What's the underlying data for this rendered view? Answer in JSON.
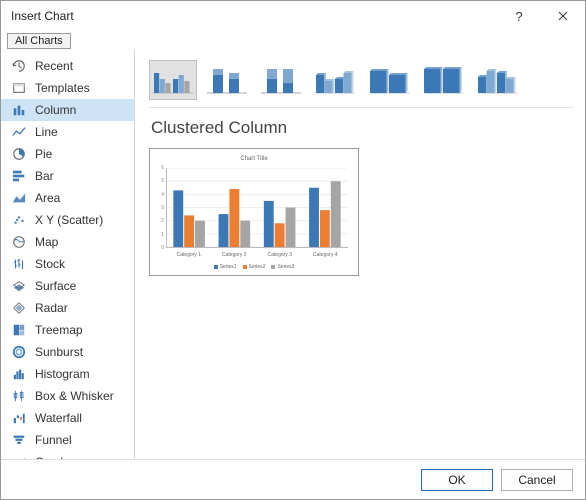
{
  "dialog": {
    "title": "Insert Chart",
    "tab_label": "All Charts"
  },
  "sidebar": {
    "items": [
      {
        "key": "recent",
        "label": "Recent"
      },
      {
        "key": "templates",
        "label": "Templates"
      },
      {
        "key": "column",
        "label": "Column"
      },
      {
        "key": "line",
        "label": "Line"
      },
      {
        "key": "pie",
        "label": "Pie"
      },
      {
        "key": "bar",
        "label": "Bar"
      },
      {
        "key": "area",
        "label": "Area"
      },
      {
        "key": "xy",
        "label": "X Y (Scatter)"
      },
      {
        "key": "map",
        "label": "Map"
      },
      {
        "key": "stock",
        "label": "Stock"
      },
      {
        "key": "surface",
        "label": "Surface"
      },
      {
        "key": "radar",
        "label": "Radar"
      },
      {
        "key": "treemap",
        "label": "Treemap"
      },
      {
        "key": "sunburst",
        "label": "Sunburst"
      },
      {
        "key": "histogram",
        "label": "Histogram"
      },
      {
        "key": "boxwhisker",
        "label": "Box & Whisker"
      },
      {
        "key": "waterfall",
        "label": "Waterfall"
      },
      {
        "key": "funnel",
        "label": "Funnel"
      },
      {
        "key": "combo",
        "label": "Combo"
      }
    ],
    "selected_key": "column"
  },
  "content": {
    "subtype_title": "Clustered Column",
    "subtype_selected_index": 0,
    "subtype_count": 7
  },
  "chart_data": {
    "type": "bar",
    "title": "Chart Title",
    "categories": [
      "Category 1",
      "Category 2",
      "Category 3",
      "Category 4"
    ],
    "series": [
      {
        "name": "Series1",
        "color": "#3b78b5",
        "values": [
          4.3,
          2.5,
          3.5,
          4.5
        ]
      },
      {
        "name": "Series2",
        "color": "#ed7d31",
        "values": [
          2.4,
          4.4,
          1.8,
          2.8
        ]
      },
      {
        "name": "Series3",
        "color": "#a5a5a5",
        "values": [
          2.0,
          2.0,
          3.0,
          5.0
        ]
      }
    ],
    "ylim": [
      0,
      6
    ],
    "yticks": [
      0,
      1,
      2,
      3,
      4,
      5,
      6
    ]
  },
  "footer": {
    "ok_label": "OK",
    "cancel_label": "Cancel"
  },
  "colors": {
    "sidebar_selected": "#cfe3f7",
    "subtype_selected": "#e1e1e1"
  }
}
